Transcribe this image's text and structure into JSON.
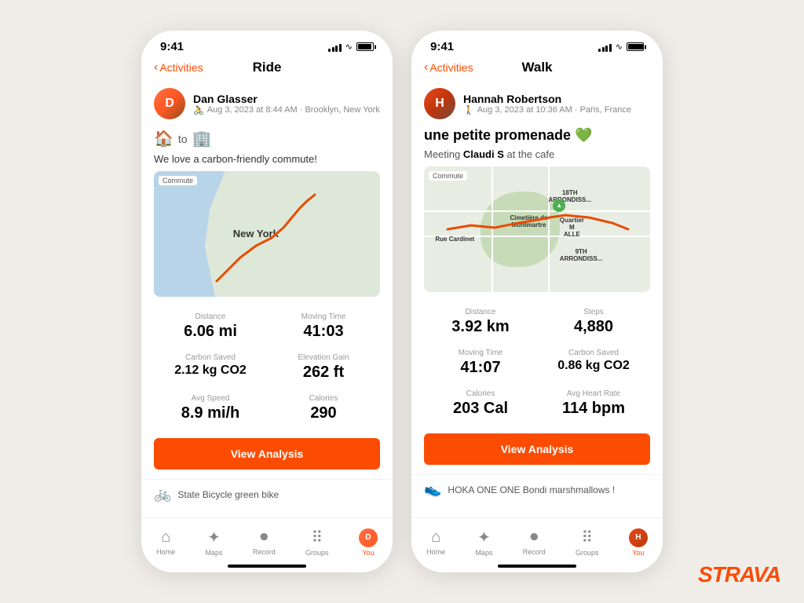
{
  "app": {
    "brand": "STRAVA"
  },
  "phone1": {
    "status_time": "9:41",
    "header": {
      "back_label": "Activities",
      "page_title": "Ride"
    },
    "user": {
      "name": "Dan Glasser",
      "meta": "Aug 3, 2023 at 8:44 AM · Brooklyn, New York"
    },
    "activity_emojis": "🏠 to 🏢",
    "activity_desc": "We love a carbon-friendly commute!",
    "stats": [
      {
        "label": "Distance",
        "value": "6.06 mi"
      },
      {
        "label": "Moving Time",
        "value": "41:03"
      },
      {
        "label": "Carbon Saved",
        "value": "2.12 kg CO2"
      },
      {
        "label": "Elevation Gain",
        "value": "262 ft"
      },
      {
        "label": "Avg Speed",
        "value": "8.9 mi/h"
      },
      {
        "label": "Calories",
        "value": "290"
      }
    ],
    "view_analysis": "View Analysis",
    "gear_label": "State Bicycle green bike",
    "nav": [
      {
        "label": "Home",
        "icon": "🏠",
        "active": false
      },
      {
        "label": "Maps",
        "icon": "🗺",
        "active": false
      },
      {
        "label": "Record",
        "icon": "⏺",
        "active": false
      },
      {
        "label": "Groups",
        "icon": "👥",
        "active": false
      },
      {
        "label": "You",
        "icon": "👤",
        "active": true
      }
    ]
  },
  "phone2": {
    "status_time": "9:41",
    "header": {
      "back_label": "Activities",
      "page_title": "Walk"
    },
    "user": {
      "name": "Hannah Robertson",
      "meta": "Aug 3, 2023 at 10:36 AM · Paris, France"
    },
    "activity_title": "une petite promenade 💚",
    "activity_subtitle_pre": "Meeting ",
    "activity_subtitle_bold": "Claudi S",
    "activity_subtitle_post": " at the cafe",
    "stats": [
      {
        "label": "Distance",
        "value": "3.92 km"
      },
      {
        "label": "Steps",
        "value": "4,880"
      },
      {
        "label": "Moving Time",
        "value": "41:07"
      },
      {
        "label": "Carbon Saved",
        "value": "0.86 kg CO2"
      },
      {
        "label": "Calories",
        "value": "203 Cal"
      },
      {
        "label": "Avg Heart Rate",
        "value": "114 bpm"
      }
    ],
    "view_analysis": "View Analysis",
    "gear_label": "HOKA ONE ONE Bondi marshmallows !",
    "nav": [
      {
        "label": "Home",
        "icon": "🏠",
        "active": false
      },
      {
        "label": "Maps",
        "icon": "🗺",
        "active": false
      },
      {
        "label": "Record",
        "icon": "⏺",
        "active": false
      },
      {
        "label": "Groups",
        "icon": "👥",
        "active": false
      },
      {
        "label": "You",
        "icon": "👤",
        "active": true
      }
    ]
  }
}
